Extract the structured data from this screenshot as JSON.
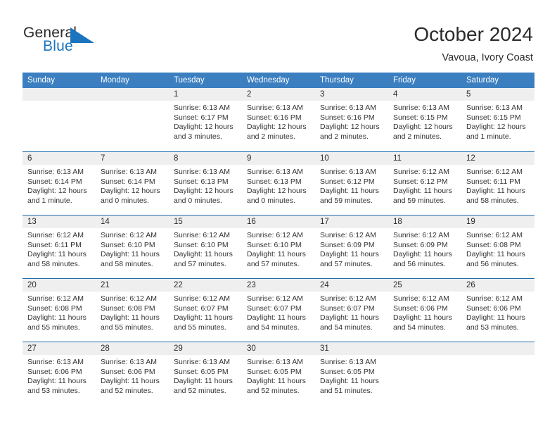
{
  "brand": {
    "word_one": "General",
    "word_two": "Blue",
    "triangle_icon": "triangle-icon",
    "blue": "#1b74bd"
  },
  "header": {
    "month_title": "October 2024",
    "location": "Vavoua, Ivory Coast"
  },
  "calendar": {
    "header_bg": "#3b7fc0",
    "separator": "#1f6cab",
    "day_band_bg": "#efefef",
    "day_names": [
      "Sunday",
      "Monday",
      "Tuesday",
      "Wednesday",
      "Thursday",
      "Friday",
      "Saturday"
    ],
    "weeks": [
      [
        {
          "date": "",
          "lines": []
        },
        {
          "date": "",
          "lines": []
        },
        {
          "date": "1",
          "lines": [
            "Sunrise: 6:13 AM",
            "Sunset: 6:17 PM",
            "Daylight: 12 hours",
            "and 3 minutes."
          ]
        },
        {
          "date": "2",
          "lines": [
            "Sunrise: 6:13 AM",
            "Sunset: 6:16 PM",
            "Daylight: 12 hours",
            "and 2 minutes."
          ]
        },
        {
          "date": "3",
          "lines": [
            "Sunrise: 6:13 AM",
            "Sunset: 6:16 PM",
            "Daylight: 12 hours",
            "and 2 minutes."
          ]
        },
        {
          "date": "4",
          "lines": [
            "Sunrise: 6:13 AM",
            "Sunset: 6:15 PM",
            "Daylight: 12 hours",
            "and 2 minutes."
          ]
        },
        {
          "date": "5",
          "lines": [
            "Sunrise: 6:13 AM",
            "Sunset: 6:15 PM",
            "Daylight: 12 hours",
            "and 1 minute."
          ]
        }
      ],
      [
        {
          "date": "6",
          "lines": [
            "Sunrise: 6:13 AM",
            "Sunset: 6:14 PM",
            "Daylight: 12 hours",
            "and 1 minute."
          ]
        },
        {
          "date": "7",
          "lines": [
            "Sunrise: 6:13 AM",
            "Sunset: 6:14 PM",
            "Daylight: 12 hours",
            "and 0 minutes."
          ]
        },
        {
          "date": "8",
          "lines": [
            "Sunrise: 6:13 AM",
            "Sunset: 6:13 PM",
            "Daylight: 12 hours",
            "and 0 minutes."
          ]
        },
        {
          "date": "9",
          "lines": [
            "Sunrise: 6:13 AM",
            "Sunset: 6:13 PM",
            "Daylight: 12 hours",
            "and 0 minutes."
          ]
        },
        {
          "date": "10",
          "lines": [
            "Sunrise: 6:13 AM",
            "Sunset: 6:12 PM",
            "Daylight: 11 hours",
            "and 59 minutes."
          ]
        },
        {
          "date": "11",
          "lines": [
            "Sunrise: 6:12 AM",
            "Sunset: 6:12 PM",
            "Daylight: 11 hours",
            "and 59 minutes."
          ]
        },
        {
          "date": "12",
          "lines": [
            "Sunrise: 6:12 AM",
            "Sunset: 6:11 PM",
            "Daylight: 11 hours",
            "and 58 minutes."
          ]
        }
      ],
      [
        {
          "date": "13",
          "lines": [
            "Sunrise: 6:12 AM",
            "Sunset: 6:11 PM",
            "Daylight: 11 hours",
            "and 58 minutes."
          ]
        },
        {
          "date": "14",
          "lines": [
            "Sunrise: 6:12 AM",
            "Sunset: 6:10 PM",
            "Daylight: 11 hours",
            "and 58 minutes."
          ]
        },
        {
          "date": "15",
          "lines": [
            "Sunrise: 6:12 AM",
            "Sunset: 6:10 PM",
            "Daylight: 11 hours",
            "and 57 minutes."
          ]
        },
        {
          "date": "16",
          "lines": [
            "Sunrise: 6:12 AM",
            "Sunset: 6:10 PM",
            "Daylight: 11 hours",
            "and 57 minutes."
          ]
        },
        {
          "date": "17",
          "lines": [
            "Sunrise: 6:12 AM",
            "Sunset: 6:09 PM",
            "Daylight: 11 hours",
            "and 57 minutes."
          ]
        },
        {
          "date": "18",
          "lines": [
            "Sunrise: 6:12 AM",
            "Sunset: 6:09 PM",
            "Daylight: 11 hours",
            "and 56 minutes."
          ]
        },
        {
          "date": "19",
          "lines": [
            "Sunrise: 6:12 AM",
            "Sunset: 6:08 PM",
            "Daylight: 11 hours",
            "and 56 minutes."
          ]
        }
      ],
      [
        {
          "date": "20",
          "lines": [
            "Sunrise: 6:12 AM",
            "Sunset: 6:08 PM",
            "Daylight: 11 hours",
            "and 55 minutes."
          ]
        },
        {
          "date": "21",
          "lines": [
            "Sunrise: 6:12 AM",
            "Sunset: 6:08 PM",
            "Daylight: 11 hours",
            "and 55 minutes."
          ]
        },
        {
          "date": "22",
          "lines": [
            "Sunrise: 6:12 AM",
            "Sunset: 6:07 PM",
            "Daylight: 11 hours",
            "and 55 minutes."
          ]
        },
        {
          "date": "23",
          "lines": [
            "Sunrise: 6:12 AM",
            "Sunset: 6:07 PM",
            "Daylight: 11 hours",
            "and 54 minutes."
          ]
        },
        {
          "date": "24",
          "lines": [
            "Sunrise: 6:12 AM",
            "Sunset: 6:07 PM",
            "Daylight: 11 hours",
            "and 54 minutes."
          ]
        },
        {
          "date": "25",
          "lines": [
            "Sunrise: 6:12 AM",
            "Sunset: 6:06 PM",
            "Daylight: 11 hours",
            "and 54 minutes."
          ]
        },
        {
          "date": "26",
          "lines": [
            "Sunrise: 6:12 AM",
            "Sunset: 6:06 PM",
            "Daylight: 11 hours",
            "and 53 minutes."
          ]
        }
      ],
      [
        {
          "date": "27",
          "lines": [
            "Sunrise: 6:13 AM",
            "Sunset: 6:06 PM",
            "Daylight: 11 hours",
            "and 53 minutes."
          ]
        },
        {
          "date": "28",
          "lines": [
            "Sunrise: 6:13 AM",
            "Sunset: 6:06 PM",
            "Daylight: 11 hours",
            "and 52 minutes."
          ]
        },
        {
          "date": "29",
          "lines": [
            "Sunrise: 6:13 AM",
            "Sunset: 6:05 PM",
            "Daylight: 11 hours",
            "and 52 minutes."
          ]
        },
        {
          "date": "30",
          "lines": [
            "Sunrise: 6:13 AM",
            "Sunset: 6:05 PM",
            "Daylight: 11 hours",
            "and 52 minutes."
          ]
        },
        {
          "date": "31",
          "lines": [
            "Sunrise: 6:13 AM",
            "Sunset: 6:05 PM",
            "Daylight: 11 hours",
            "and 51 minutes."
          ]
        },
        {
          "date": "",
          "lines": []
        },
        {
          "date": "",
          "lines": []
        }
      ]
    ]
  }
}
